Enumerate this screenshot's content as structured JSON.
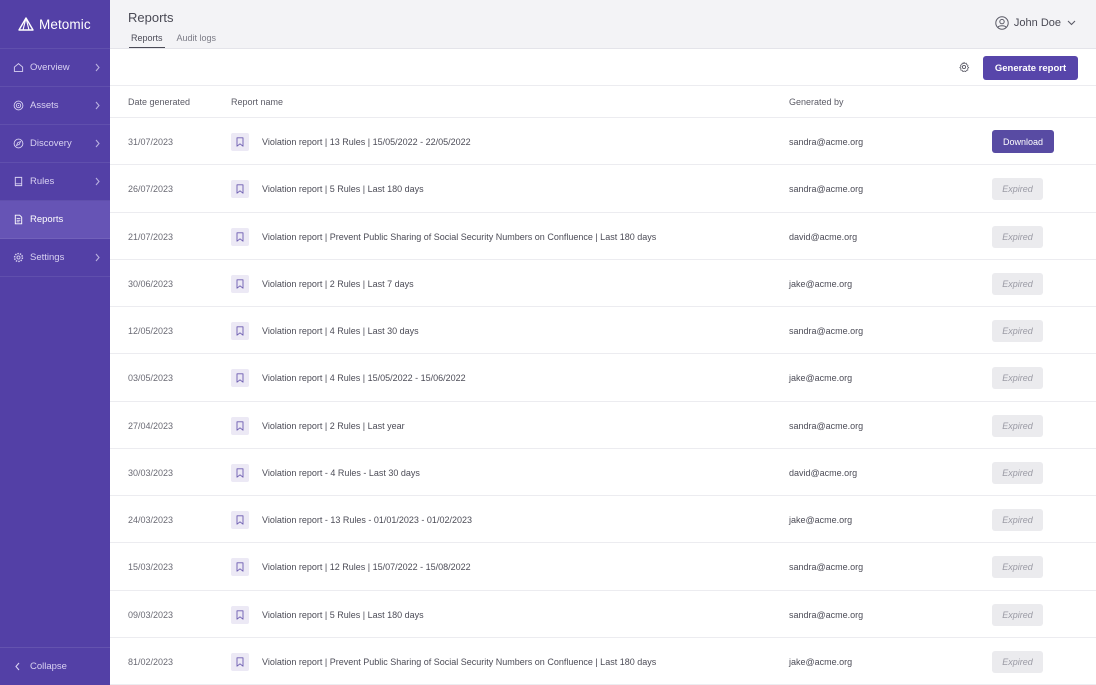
{
  "app": {
    "brand": "Metomic"
  },
  "sidebar": {
    "items": [
      {
        "label": "Overview",
        "icon": "home-icon",
        "active": false,
        "has_chevron": true
      },
      {
        "label": "Assets",
        "icon": "target-icon",
        "active": false,
        "has_chevron": true
      },
      {
        "label": "Discovery",
        "icon": "compass-icon",
        "active": false,
        "has_chevron": true
      },
      {
        "label": "Rules",
        "icon": "book-icon",
        "active": false,
        "has_chevron": true
      },
      {
        "label": "Reports",
        "icon": "document-icon",
        "active": true,
        "has_chevron": false
      },
      {
        "label": "Settings",
        "icon": "gear-icon",
        "active": false,
        "has_chevron": true
      }
    ],
    "collapse_label": "Collapse"
  },
  "header": {
    "title": "Reports",
    "tabs": [
      {
        "label": "Reports",
        "active": true
      },
      {
        "label": "Audit logs",
        "active": false
      }
    ],
    "user_name": "John Doe"
  },
  "toolbar": {
    "generate_label": "Generate report"
  },
  "table": {
    "columns": {
      "date": "Date generated",
      "name": "Report name",
      "by": "Generated by"
    },
    "rows": [
      {
        "date": "31/07/2023",
        "name": "Violation report | 13 Rules | 15/05/2022 - 22/05/2022",
        "by": "sandra@acme.org",
        "status": "download",
        "action": "Download"
      },
      {
        "date": "26/07/2023",
        "name": "Violation report | 5 Rules | Last 180 days",
        "by": "sandra@acme.org",
        "status": "expired",
        "action": "Expired"
      },
      {
        "date": "21/07/2023",
        "name": "Violation report | Prevent Public Sharing of Social Security Numbers on Confluence | Last 180 days",
        "by": "david@acme.org",
        "status": "expired",
        "action": "Expired"
      },
      {
        "date": "30/06/2023",
        "name": "Violation report | 2 Rules | Last 7 days",
        "by": "jake@acme.org",
        "status": "expired",
        "action": "Expired"
      },
      {
        "date": "12/05/2023",
        "name": "Violation report | 4 Rules | Last 30 days",
        "by": "sandra@acme.org",
        "status": "expired",
        "action": "Expired"
      },
      {
        "date": "03/05/2023",
        "name": "Violation report | 4 Rules | 15/05/2022 - 15/06/2022",
        "by": "jake@acme.org",
        "status": "expired",
        "action": "Expired"
      },
      {
        "date": "27/04/2023",
        "name": "Violation report | 2 Rules | Last year",
        "by": "sandra@acme.org",
        "status": "expired",
        "action": "Expired"
      },
      {
        "date": "30/03/2023",
        "name": "Violation report - 4 Rules - Last 30 days",
        "by": "david@acme.org",
        "status": "expired",
        "action": "Expired"
      },
      {
        "date": "24/03/2023",
        "name": "Violation report - 13 Rules - 01/01/2023 - 01/02/2023",
        "by": "jake@acme.org",
        "status": "expired",
        "action": "Expired"
      },
      {
        "date": "15/03/2023",
        "name": "Violation report | 12 Rules | 15/07/2022 - 15/08/2022",
        "by": "sandra@acme.org",
        "status": "expired",
        "action": "Expired"
      },
      {
        "date": "09/03/2023",
        "name": "Violation report | 5 Rules | Last 180 days",
        "by": "sandra@acme.org",
        "status": "expired",
        "action": "Expired"
      },
      {
        "date": "81/02/2023",
        "name": "Violation report | Prevent Public Sharing of Social Security Numbers on Confluence | Last 180 days",
        "by": "jake@acme.org",
        "status": "expired",
        "action": "Expired"
      }
    ]
  },
  "colors": {
    "sidebar_bg": "#5340a6",
    "accent": "#5745aa",
    "expired_bg": "#ebebee"
  }
}
